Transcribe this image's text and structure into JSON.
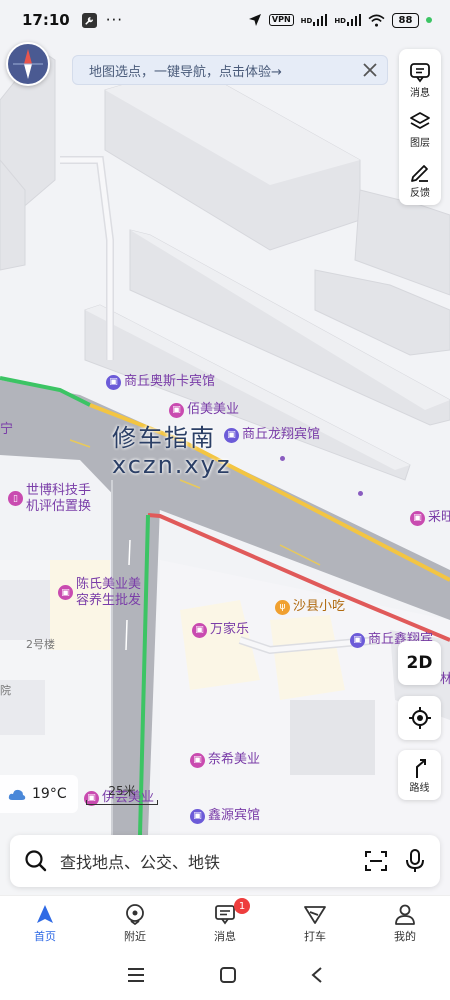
{
  "status_bar": {
    "time": "17:10",
    "vpn": "VPN",
    "hd1": "HD",
    "hd2": "HD",
    "battery": "88"
  },
  "notice": {
    "text": "地图选点，一键导航，点击体验→"
  },
  "tools": {
    "messages_label": "消息",
    "layers_label": "图层",
    "feedback_label": "反馈"
  },
  "map": {
    "watermark_line1": "修车指南",
    "watermark_line2": "xczn.xyz",
    "poi": {
      "osca_hotel": "商丘奥斯卡宾馆",
      "baimei": "佰美美业",
      "longxiang_hotel": "商丘龙翔宾馆",
      "shibo": "世博科技手机评估置换",
      "caiwang": "采旺",
      "chen": "陈氏美业美容养生批发",
      "shaxian": "沙县小吃",
      "wanjiale": "万家乐",
      "building2": "2号楼",
      "xinxin_hotel": "商丘鑫翔宾",
      "lin": "林",
      "naixi": "奈希美业",
      "yiyun": "伊芸美业",
      "xinyuan_hotel": "鑫源宾馆",
      "left_edge_1": "宁",
      "left_edge_2": "院"
    },
    "accent_route": "#3cc464",
    "congestion_color": "#e05a5a",
    "slow_color": "#f3c542"
  },
  "controls": {
    "mode_label": "2D",
    "route_label": "路线"
  },
  "weather": {
    "temperature": "19°C"
  },
  "scale": {
    "label": "25米"
  },
  "search": {
    "placeholder": "查找地点、公交、地铁"
  },
  "bottom_nav": {
    "items": [
      {
        "label": "首页",
        "icon": "home-arrow-icon",
        "active": true
      },
      {
        "label": "附近",
        "icon": "nearby-pin-icon",
        "active": false
      },
      {
        "label": "消息",
        "icon": "message-icon",
        "active": false,
        "badge": "1"
      },
      {
        "label": "打车",
        "icon": "taxi-icon",
        "active": false
      },
      {
        "label": "我的",
        "icon": "profile-icon",
        "active": false
      }
    ]
  }
}
